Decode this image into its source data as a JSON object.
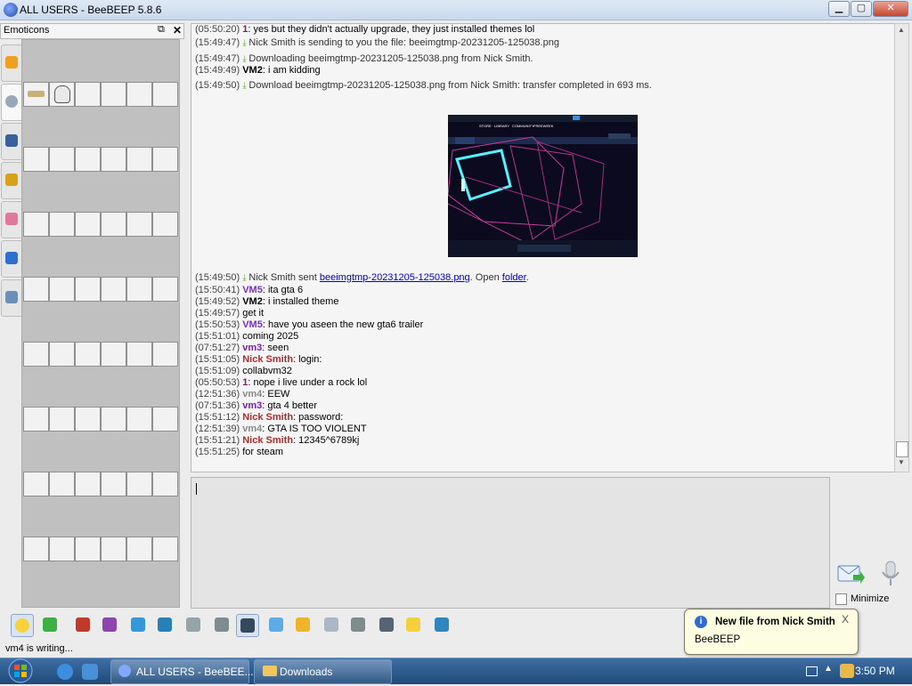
{
  "window": {
    "title": "ALL USERS - BeeBEEP 5.8.6",
    "minimize": "▁",
    "maximize": "▢",
    "close": "✕"
  },
  "sidebar": {
    "title": "Emoticons",
    "float_icon": "⧉",
    "close_icon": "✕",
    "tabs": [
      "recent-emoji-icon",
      "clock-icon",
      "objects-icon",
      "megaphone-icon",
      "flower-icon",
      "building-icon",
      "symbols-icon"
    ]
  },
  "chat": {
    "lines": [
      {
        "ts": "(05:50:20)",
        "name": "1",
        "cls": "nm-1",
        "text": " yes but they didn't actually upgrade, they just installed themes lol"
      },
      {
        "ts": "(15:49:47)",
        "icon": true,
        "sys": "Nick Smith is sending to you the file: beeimgtmp-20231205-125038.png"
      },
      {
        "ts": "(15:49:47)",
        "icon": true,
        "sys": "Downloading beeimgtmp-20231205-125038.png from Nick Smith."
      },
      {
        "ts": "(15:49:49)",
        "name": "VM2",
        "cls": "nm-vm2",
        "text": " i am kidding"
      },
      {
        "ts": "(15:49:50)",
        "icon": true,
        "sys": "Download beeimgtmp-20231205-125038.png from Nick Smith: transfer completed in 693 ms."
      }
    ],
    "sent_line": {
      "ts": "(15:49:50)",
      "pre": "Nick Smith sent ",
      "file": "beeimgtmp-20231205-125038.png",
      "mid": ". Open ",
      "folder": "folder",
      "post": "."
    },
    "lines2": [
      {
        "ts": "(15:50:41)",
        "name": "VM5",
        "cls": "nm-vm5",
        "text": " ita gta 6"
      },
      {
        "ts": "(15:49:52)",
        "name": "VM2",
        "cls": "nm-vm2",
        "text": " i installed theme"
      },
      {
        "ts": "(15:49:57)",
        "text": "   get it"
      },
      {
        "ts": "(15:50:53)",
        "name": "VM5",
        "cls": "nm-vm5",
        "text": " have you aseen the new gta6 trailer"
      },
      {
        "ts": "(15:51:01)",
        "text": "   coming 2025"
      },
      {
        "ts": "(07:51:27)",
        "name": "vm3",
        "cls": "nm-vm3",
        "text": " seen"
      },
      {
        "ts": "(15:51:05)",
        "name": "Nick Smith",
        "cls": "nm-nick",
        "text": " login:"
      },
      {
        "ts": "(15:51:09)",
        "text": "   collabvm32"
      },
      {
        "ts": "(05:50:53)",
        "name": "1",
        "cls": "nm-1",
        "text": " nope i live under a rock lol"
      },
      {
        "ts": "(12:51:36)",
        "name": "vm4",
        "cls": "nm-vm4",
        "text": " EEW"
      },
      {
        "ts": "(07:51:36)",
        "name": "vm3",
        "cls": "nm-vm3",
        "text": " gta 4 better"
      },
      {
        "ts": "(15:51:12)",
        "name": "Nick Smith",
        "cls": "nm-nick",
        "text": " password:"
      },
      {
        "ts": "(12:51:39)",
        "name": "vm4",
        "cls": "nm-vm4",
        "text": " GTA IS TOO VIOLENT"
      },
      {
        "ts": "(15:51:21)",
        "name": "Nick Smith",
        "cls": "nm-nick",
        "text": " 12345^6789kj"
      },
      {
        "ts": "(15:51:25)",
        "text": "   for steam"
      }
    ],
    "thumbnail_menu": [
      "STORE",
      "LIBRARY",
      "COMMUNITY",
      "FREEWEEK"
    ]
  },
  "compose": {
    "minimize_label": "Minimize"
  },
  "toolbar": [
    "emoticon-icon",
    "gem-icon",
    "font-icon",
    "color-picker-icon",
    "filter-icon",
    "settings-icon",
    "spellcheck-icon",
    "dictionary-icon",
    "music-note-icon",
    "file-icon",
    "send-file-icon",
    "code-icon",
    "screenshot-icon",
    "window-icon",
    "notes-icon",
    "save-icon"
  ],
  "status": {
    "text": "vm4 is writing..."
  },
  "taskbar": {
    "items": [
      {
        "label": "ALL USERS - BeeBEE..."
      },
      {
        "label": "Downloads"
      }
    ],
    "clock": "3:50 PM"
  },
  "notification": {
    "title": "New file from Nick Smith",
    "body": "BeeBEEP",
    "close": "X"
  }
}
